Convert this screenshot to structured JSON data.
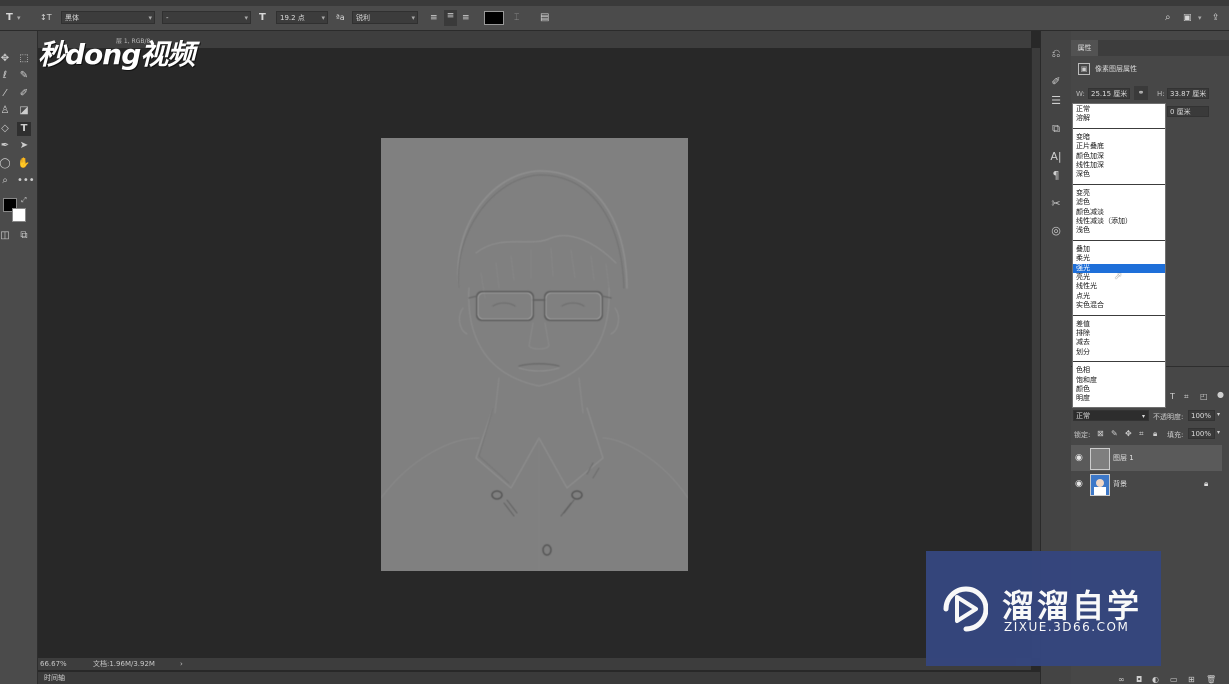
{
  "options_bar": {
    "tool_glyph": "T",
    "orient_glyph": "↕T",
    "font_family": "黑体",
    "font_style": "-",
    "size_glyph": "T",
    "font_size": "19.2 点",
    "aa_glyph": "ªa",
    "antialias": "锐利",
    "swatch_color": "#000000"
  },
  "doc_tab": {
    "title": "层 1, RGB/8"
  },
  "logo": {
    "text": "秒dong视频"
  },
  "status": {
    "zoom": "66.67%",
    "doc_info": "文档:1.96M/3.92M",
    "arrow": "›"
  },
  "timeline": {
    "label": "时间轴"
  },
  "properties": {
    "tab": "属性",
    "subtitle": "像素图层属性",
    "w_label": "W:",
    "w_value": "25.15 厘米",
    "link_glyph": "⚭",
    "h_label": "H:",
    "h_value": "33.87 厘米",
    "y_value": "0 厘米"
  },
  "blend_menu": {
    "groups": [
      [
        "正常",
        "溶解"
      ],
      [
        "变暗",
        "正片叠底",
        "颜色加深",
        "线性加深",
        "深色"
      ],
      [
        "变亮",
        "滤色",
        "颜色减淡",
        "线性减淡（添加）",
        "浅色"
      ],
      [
        "叠加",
        "柔光",
        "强光",
        "亮光",
        "线性光",
        "点光",
        "实色混合"
      ],
      [
        "差值",
        "排除",
        "减去",
        "划分"
      ],
      [
        "色相",
        "饱和度",
        "颜色",
        "明度"
      ]
    ],
    "selected": "强光"
  },
  "layers": {
    "blend_mode": "正常",
    "opacity_label": "不透明度:",
    "opacity_value": "100%",
    "lock_label": "锁定:",
    "fill_label": "填充:",
    "fill_value": "100%",
    "items": [
      {
        "name": "图层 1"
      },
      {
        "name": "背景"
      }
    ]
  },
  "watermark": {
    "title": "溜溜自学",
    "url": "ZIXUE.3D66.COM"
  }
}
